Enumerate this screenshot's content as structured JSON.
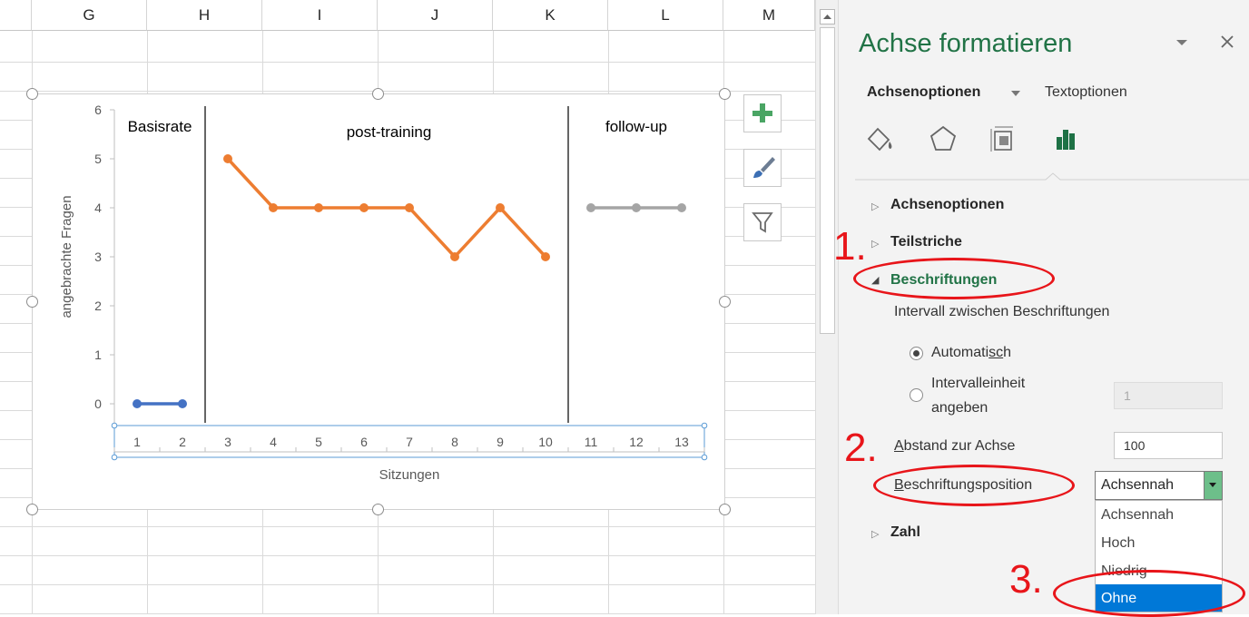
{
  "sheet": {
    "columns": [
      "G",
      "H",
      "I",
      "J",
      "K",
      "L",
      "M"
    ]
  },
  "chart": {
    "section_labels": [
      "Basisrate",
      "post-training",
      "follow-up"
    ],
    "xlabel": "Sitzungen",
    "ylabel": "angebrachte Fragen",
    "side_buttons": [
      "add-chart-element",
      "chart-styles",
      "chart-filters"
    ]
  },
  "chart_data": {
    "type": "line",
    "x": [
      1,
      2,
      3,
      4,
      5,
      6,
      7,
      8,
      9,
      10,
      11,
      12,
      13
    ],
    "series": [
      {
        "x": [
          1,
          2
        ],
        "values": [
          0,
          0
        ],
        "color": "#4472c4"
      },
      {
        "x": [
          3,
          4,
          5,
          6,
          7,
          8,
          9,
          10
        ],
        "values": [
          5,
          4,
          4,
          4,
          4,
          3,
          4,
          3
        ],
        "color": "#ed7d31"
      },
      {
        "x": [
          11,
          12,
          13
        ],
        "values": [
          4,
          4,
          4
        ],
        "color": "#a5a5a5"
      }
    ],
    "phase_lines_after": [
      2,
      10
    ],
    "xlabel": "Sitzungen",
    "ylabel": "angebrachte Fragen",
    "ylim": [
      0,
      6
    ],
    "yticks": [
      "0",
      "1",
      "2",
      "3",
      "4",
      "5",
      "6"
    ],
    "xticks": [
      "1",
      "2",
      "3",
      "4",
      "5",
      "6",
      "7",
      "8",
      "9",
      "10",
      "11",
      "12",
      "13"
    ],
    "annotations": [
      "Basisrate",
      "post-training",
      "follow-up"
    ],
    "grid": false
  },
  "pane": {
    "title": "Achse formatieren",
    "tab_axis_options": "Achsenoptionen",
    "tab_text_options": "Textoptionen",
    "sections": {
      "achsenoptionen": "Achsenoptionen",
      "teilstriche": "Teilstriche",
      "beschriftungen": "Beschriftungen",
      "zahl": "Zahl"
    },
    "interval_label": "Intervall zwischen Beschriftungen",
    "radio_auto": "Automatisch",
    "radio_interval_line1": "Intervalleinheit",
    "radio_interval_line2": "angeben",
    "interval_value": "1",
    "distance_label": "Abstand zur Achse",
    "distance_value": "100",
    "position_label": "Beschriftungsposition",
    "position_value": "Achsennah",
    "dropdown_options": [
      "Achsennah",
      "Hoch",
      "Niedrig",
      "Ohne"
    ],
    "highlighted_option": "Ohne"
  },
  "annotations": {
    "step1": "1.",
    "step2": "2.",
    "step3": "3."
  },
  "colors": {
    "accent_green": "#217346",
    "annotation_red": "#e8151a",
    "highlight_blue": "#0078d7"
  }
}
